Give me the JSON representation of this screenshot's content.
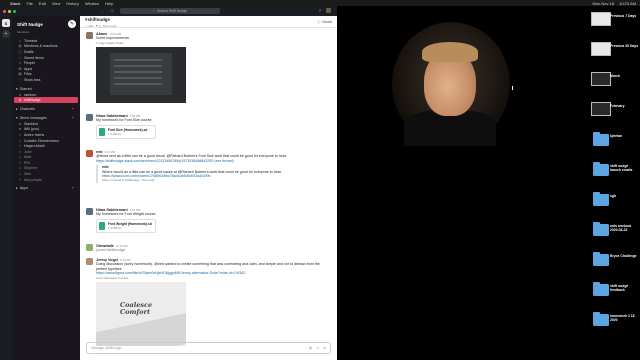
{
  "menubar": {
    "items": [
      "Slack",
      "File",
      "Edit",
      "View",
      "History",
      "Window",
      "Help"
    ],
    "right": [
      "Mon Nov 18",
      "10:23 AM"
    ]
  },
  "topbar": {
    "search_placeholder": "Search Shift Nudge"
  },
  "workspace": {
    "name": "Shift Nudge",
    "badge": "S",
    "subtitle": "Members"
  },
  "sidebar": {
    "top_items": [
      {
        "icon": "•",
        "label": "Threads"
      },
      {
        "icon": "@",
        "label": "Mentions & reactions"
      },
      {
        "icon": "▢",
        "label": "Drafts"
      },
      {
        "icon": "☆",
        "label": "Saved items"
      },
      {
        "icon": "☺",
        "label": "People"
      },
      {
        "icon": "⊞",
        "label": "Apps"
      },
      {
        "icon": "▤",
        "label": "Files"
      },
      {
        "icon": "⋮",
        "label": "Show less"
      }
    ],
    "starred_label": "Starred",
    "starred": [
      "random",
      "shiftnudge"
    ],
    "channels_label": "Channels",
    "dm_label": "Direct messages",
    "dms": [
      "Slackbot",
      "Will (you)",
      "Andre Harris",
      "Coralee Zimmermann",
      "Hagen Alrahi",
      "Josh",
      "Matt",
      "Phil",
      "Stephen",
      "Wes"
    ],
    "add_people": "Add people",
    "apps_label": "Apps"
  },
  "channel": {
    "name": "#shiftnudge",
    "meta": "☆  236  ·  ⚑ 3  ·  Add a topic",
    "details": "Details"
  },
  "messages": [
    {
      "author": "Akane",
      "time": "10:03 AM",
      "text": "Some improvements",
      "sub": "1 reply  Aufgabe  Today"
    },
    {
      "author": "Nima Sakhtemani",
      "time": "4:08 PM",
      "text": "My homework for Font Size course",
      "file": "Font Size (Homework).sd",
      "file_meta": "1.9 MB  Zip"
    },
    {
      "author": "eeb",
      "time": "6:12 PM",
      "text": "@Nima sent as a little can be a good result. @Richard Buterin's Font Size work that could be good for everyone to hear.",
      "link": "https://shiftnudge.slack.com/archives/C0123456789/p1573038458843200  (see thread)",
      "quote_author": "eeb",
      "quote_text": "Where would an a little can be a good cause at @Richard Buterin's work that could be good for everyone to hear",
      "quote_link": "https://www.loom.com/share/1/76d5f1b8bc76a4a4b54fc4f33a1b1f9b",
      "quote_meta": "Share in thread in #shiftnudge  · View reply"
    },
    {
      "author": "Nima Sakhtemani",
      "time": "6:14 PM",
      "text": "My homework for Font Weight course",
      "file": "Font Weight (Homework).sd",
      "file_meta": "1.9 MB  Zip"
    },
    {
      "author": "Olowdaile",
      "time": "11:16 AM",
      "text": "joined #shiftnudge."
    },
    {
      "author": "Jenny Vogel",
      "time": "5:40 PM",
      "text": "Doing discussion (sorry homework). @eeb wanted to create something that was comforting and calm, and simple and not to distract from the perfect typeface",
      "link": "https://www.figma.com/file/cd78am0nNjxHO8jggoMK/Jenny-alternative-Suite?node-id=1%3A2",
      "sub": "Jenny Alternative Comfort"
    }
  ],
  "poster": {
    "line1": "Coalesce",
    "line2": "Comfort"
  },
  "composer": {
    "placeholder": "Message #shiftnudge"
  },
  "desktop": [
    {
      "label": "Previous 7 Days",
      "kind": "img-light"
    },
    {
      "label": "Previous 30 Days",
      "kind": "img-light"
    },
    {
      "label": "March",
      "kind": "img-dark"
    },
    {
      "label": "February",
      "kind": "img-dark"
    },
    {
      "label": "kjiretan",
      "kind": "folder"
    },
    {
      "label": "shift nudge launch emails",
      "kind": "folder"
    },
    {
      "label": "sgh",
      "kind": "folder"
    },
    {
      "label": "mds workout 2020-03-23",
      "kind": "folder"
    },
    {
      "label": "Bryce Challenge",
      "kind": "folder"
    },
    {
      "label": "shift nudge feedback",
      "kind": "folder"
    },
    {
      "label": "homework 3 18 2020",
      "kind": "folder"
    }
  ]
}
